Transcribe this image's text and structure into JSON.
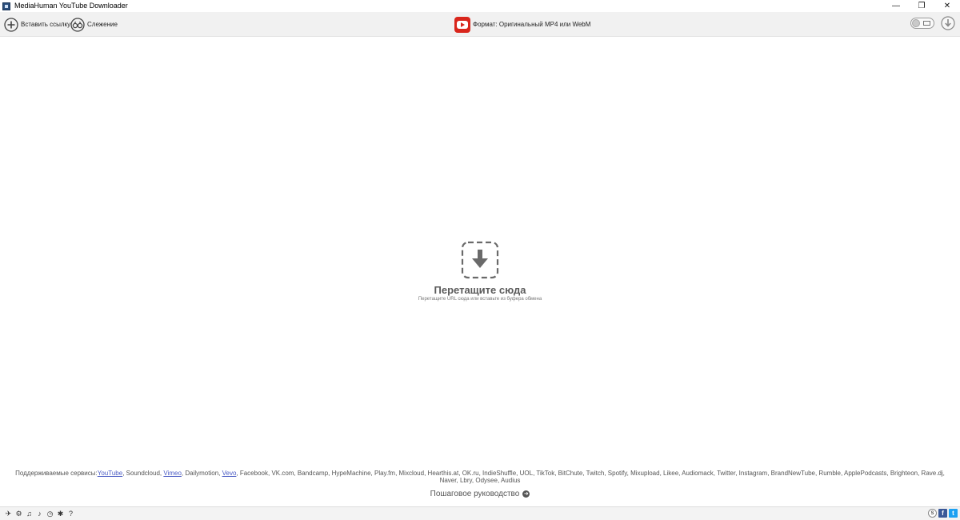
{
  "window": {
    "title": "MediaHuman YouTube Downloader",
    "controls": {
      "minimize": "—",
      "restore": "❐",
      "close": "✕"
    }
  },
  "toolbar": {
    "paste_label": "Вставить ссылку",
    "tracking_label": "Слежение",
    "format_label": "Формат: Оригинальный MP4 или WebM",
    "accent_color": "#d9261c"
  },
  "drop_zone": {
    "title": "Перетащите сюда",
    "subtitle": "Перетащите URL сюда или вставьте из буфера обмена"
  },
  "services": {
    "prefix": "Поддерживаемые сервисы:",
    "items": [
      {
        "name": "YouTube",
        "link": true
      },
      {
        "name": "Soundcloud",
        "link": false
      },
      {
        "name": "Vimeo",
        "link": true
      },
      {
        "name": "Dailymotion",
        "link": false
      },
      {
        "name": "Vevo",
        "link": true
      },
      {
        "name": "Facebook",
        "link": false
      },
      {
        "name": "VK.com",
        "link": false
      },
      {
        "name": "Bandcamp",
        "link": false
      },
      {
        "name": "HypeMachine",
        "link": false
      },
      {
        "name": "Play.fm",
        "link": false
      },
      {
        "name": "Mixcloud",
        "link": false
      },
      {
        "name": "Hearthis.at",
        "link": false
      },
      {
        "name": "OK.ru",
        "link": false
      },
      {
        "name": "IndieShuffle",
        "link": false
      },
      {
        "name": "UOL",
        "link": false
      },
      {
        "name": "TikTok",
        "link": false
      },
      {
        "name": "BitChute",
        "link": false
      },
      {
        "name": "Twitch",
        "link": false
      },
      {
        "name": "Spotify",
        "link": false
      },
      {
        "name": "Mixupload",
        "link": false
      },
      {
        "name": "Likee",
        "link": false
      },
      {
        "name": "Audiomack",
        "link": false
      },
      {
        "name": "Twitter",
        "link": false
      },
      {
        "name": "Instagram",
        "link": false
      },
      {
        "name": "BrandNewTube",
        "link": false
      },
      {
        "name": "Rumble",
        "link": false
      },
      {
        "name": "ApplePodcasts",
        "link": false
      },
      {
        "name": "Brighteon",
        "link": false
      },
      {
        "name": "Rave.dj",
        "link": false
      },
      {
        "name": "Naver",
        "link": false
      },
      {
        "name": "Lbry",
        "link": false
      },
      {
        "name": "Odysee",
        "link": false
      },
      {
        "name": "Audius",
        "link": false
      }
    ],
    "link_color": "#4a5bc4"
  },
  "guide": {
    "label": "Пошаговое руководство",
    "arrow": "➜"
  },
  "statusbar": {
    "left_icons": [
      {
        "name": "send-icon",
        "glyph": "✈"
      },
      {
        "name": "gear-icon",
        "glyph": "⚙"
      },
      {
        "name": "music-icon",
        "glyph": "♫"
      },
      {
        "name": "bird-icon",
        "glyph": "♪"
      },
      {
        "name": "clock-icon",
        "glyph": "◷"
      },
      {
        "name": "bug-icon",
        "glyph": "✱"
      },
      {
        "name": "help-icon",
        "glyph": "?"
      }
    ],
    "right_icons": [
      {
        "name": "skype-icon",
        "glyph": "S"
      },
      {
        "name": "facebook-icon",
        "glyph": "f"
      },
      {
        "name": "twitter-icon",
        "glyph": "t"
      }
    ]
  }
}
